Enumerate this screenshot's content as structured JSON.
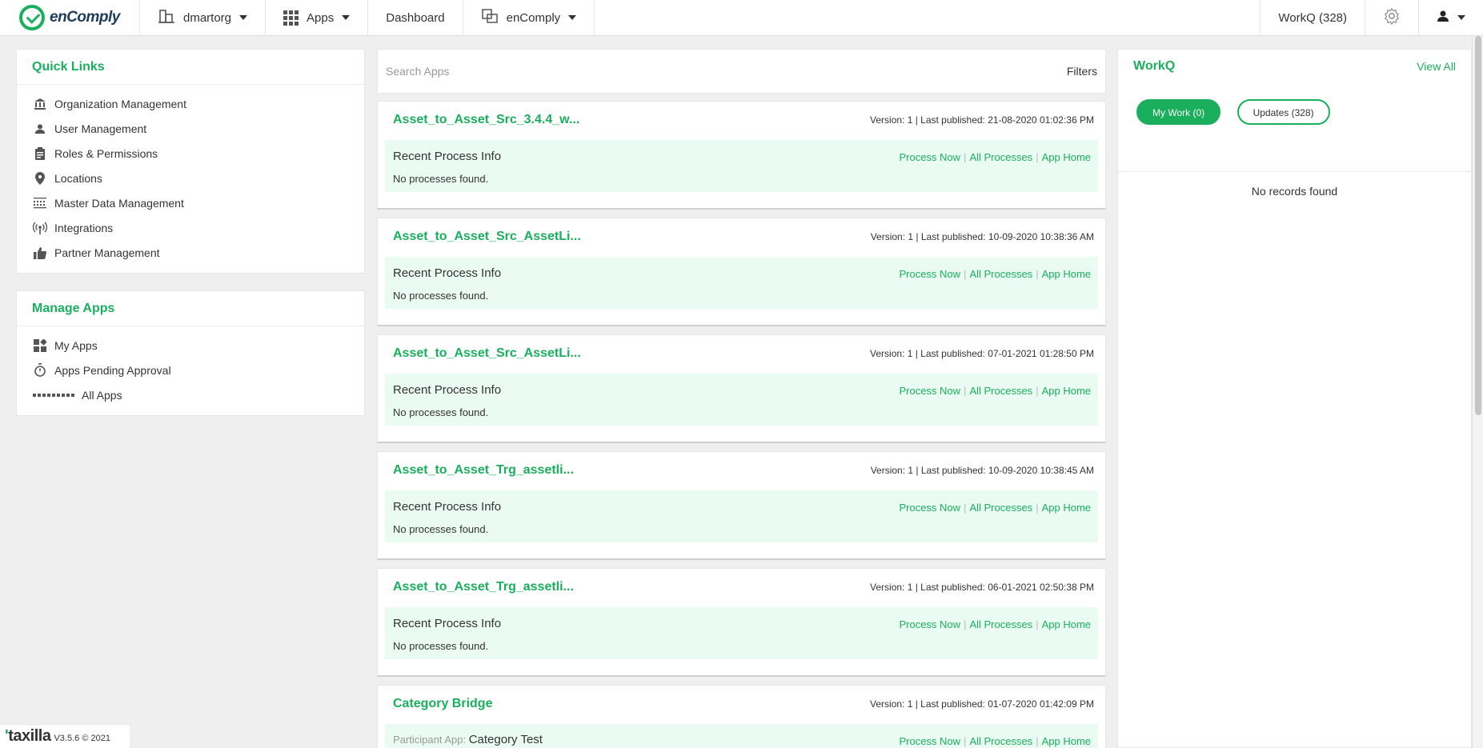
{
  "brand": {
    "name": "enComply"
  },
  "nav": {
    "org": "dmartorg",
    "apps": "Apps",
    "dashboard": "Dashboard",
    "context": "enComply",
    "workq": "WorkQ (328)"
  },
  "quick_links": {
    "title": "Quick Links",
    "items": [
      {
        "label": "Organization Management",
        "icon": "bank-icon"
      },
      {
        "label": "User Management",
        "icon": "user-icon"
      },
      {
        "label": "Roles & Permissions",
        "icon": "clipboard-icon"
      },
      {
        "label": "Locations",
        "icon": "location-pin-icon"
      },
      {
        "label": "Master Data Management",
        "icon": "grid-list-icon"
      },
      {
        "label": "Integrations",
        "icon": "antenna-icon"
      },
      {
        "label": "Partner Management",
        "icon": "thumbs-up-icon"
      }
    ]
  },
  "manage_apps": {
    "title": "Manage Apps",
    "items": [
      {
        "label": "My Apps",
        "icon": "widgets-icon"
      },
      {
        "label": "Apps Pending Approval",
        "icon": "stopwatch-icon"
      },
      {
        "label": "All Apps",
        "icon": "apps-grid-icon"
      }
    ]
  },
  "search": {
    "placeholder": "Search Apps",
    "filters": "Filters"
  },
  "apps": [
    {
      "title": "Asset_to_Asset_Src_3.4.4_w...",
      "meta": "Version: 1 | Last published: 21-08-2020 01:02:36 PM",
      "recent": "Recent Process Info",
      "status": "No processes found."
    },
    {
      "title": "Asset_to_Asset_Src_AssetLi...",
      "meta": "Version: 1 | Last published: 10-09-2020 10:38:36 AM",
      "recent": "Recent Process Info",
      "status": "No processes found."
    },
    {
      "title": "Asset_to_Asset_Src_AssetLi...",
      "meta": "Version: 1 | Last published: 07-01-2021 01:28:50 PM",
      "recent": "Recent Process Info",
      "status": "No processes found."
    },
    {
      "title": "Asset_to_Asset_Trg_assetli...",
      "meta": "Version: 1 | Last published: 10-09-2020 10:38:45 AM",
      "recent": "Recent Process Info",
      "status": "No processes found."
    },
    {
      "title": "Asset_to_Asset_Trg_assetli...",
      "meta": "Version: 1 | Last published: 06-01-2021 02:50:38 PM",
      "recent": "Recent Process Info",
      "status": "No processes found."
    },
    {
      "title": "Category Bridge",
      "meta": "Version: 1 | Last published: 01-07-2020 01:42:09 PM",
      "participant_label": "Participant App:",
      "participant_value": "Category Test"
    }
  ],
  "card_links": {
    "process_now": "Process Now",
    "all_processes": "All Processes",
    "app_home": "App Home"
  },
  "workq": {
    "title": "WorkQ",
    "view_all": "View All",
    "my_work": "My Work (0)",
    "updates": "Updates (328)",
    "empty": "No records found"
  },
  "footer": {
    "logo": "taxilla",
    "version": "V3.5.6 © 2021"
  },
  "colors": {
    "accent": "#1aaf5d",
    "info_bg": "#e9fbf2"
  }
}
